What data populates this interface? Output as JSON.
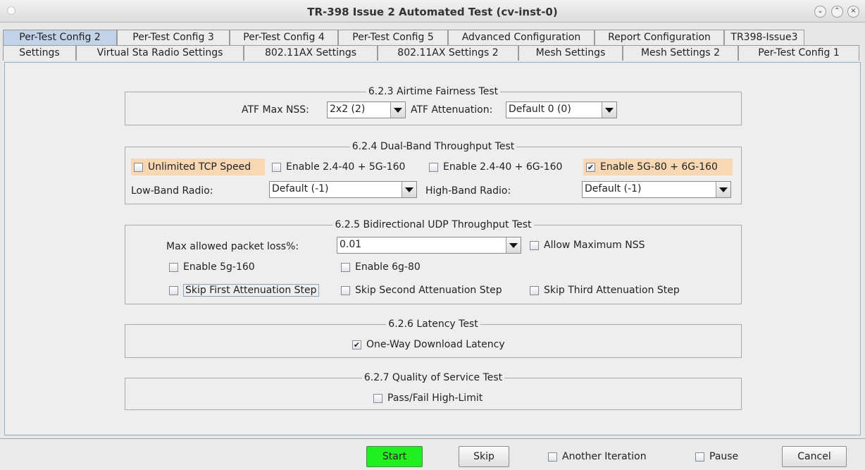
{
  "window": {
    "title": "TR-398 Issue 2 Automated Test  (cv-inst-0)",
    "controls": [
      "chevron-down-icon",
      "chevron-up-icon",
      "close-icon"
    ]
  },
  "tabs": {
    "row1": [
      "Per-Test Config 2",
      "Per-Test Config 3",
      "Per-Test Config 4",
      "Per-Test Config 5",
      "Advanced Configuration",
      "Report Configuration",
      "TR398-Issue3"
    ],
    "row2": [
      "Settings",
      "Virtual Sta Radio Settings",
      "802.11AX Settings",
      "802.11AX Settings 2",
      "Mesh Settings",
      "Mesh Settings 2",
      "Per-Test Config 1"
    ],
    "active": "Per-Test Config 2"
  },
  "airtime": {
    "title": "6.2.3 Airtime Fairness Test",
    "max_nss_label": "ATF Max NSS:",
    "max_nss_value": "2x2 (2)",
    "attenuation_label": "ATF Attenuation:",
    "attenuation_value": "Default 0 (0)"
  },
  "dualband": {
    "title": "6.2.4 Dual-Band Throughput Test",
    "unlimited_tcp": "Unlimited TCP Speed",
    "enable_24_5g": "Enable 2.4-40 + 5G-160",
    "enable_24_6g": "Enable 2.4-40 + 6G-160",
    "enable_5g_6g": "Enable 5G-80  + 6G-160",
    "low_band_label": "Low-Band Radio:",
    "low_band_value": "Default (-1)",
    "high_band_label": "High-Band Radio:",
    "high_band_value": "Default (-1)"
  },
  "bidir": {
    "title": "6.2.5 Bidirectional UDP Throughput Test",
    "max_loss_label": "Max allowed packet loss%:",
    "max_loss_value": "0.01",
    "allow_max_nss": "Allow Maximum NSS",
    "enable_5g160": "Enable 5g-160",
    "enable_6g80": "Enable 6g-80",
    "skip_first": "Skip First Attenuation Step",
    "skip_second": "Skip Second Attenuation Step",
    "skip_third": "Skip Third Attenuation Step"
  },
  "latency": {
    "title": "6.2.6 Latency Test",
    "one_way": "One-Way Download Latency"
  },
  "qos": {
    "title": "6.2.7 Quality of Service Test",
    "pass_fail": "Pass/Fail High-Limit"
  },
  "bottom": {
    "start": "Start",
    "skip": "Skip",
    "another_iteration": "Another Iteration",
    "pause": "Pause",
    "cancel": "Cancel"
  },
  "checked": {
    "unlimited_tcp": false,
    "enable_24_5g": false,
    "enable_24_6g": false,
    "enable_5g_6g": true,
    "allow_max_nss": false,
    "enable_5g160": false,
    "enable_6g80": false,
    "skip_first": false,
    "skip_second": false,
    "skip_third": false,
    "one_way": true,
    "pass_fail": false,
    "another_iteration": false,
    "pause": false
  },
  "colors": {
    "start_button": "#22ee22",
    "highlight": "#f8d8b4",
    "active_tab": "#c2d3e8"
  }
}
